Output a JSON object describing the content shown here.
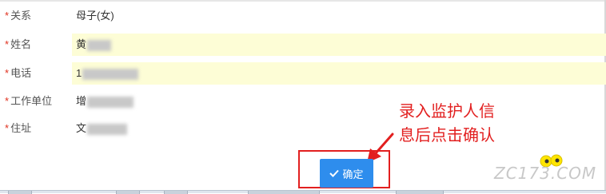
{
  "form": {
    "fields": [
      {
        "label": "关系",
        "value": "母子(女)",
        "required": true
      },
      {
        "label": "姓名",
        "value": "黄",
        "required": true
      },
      {
        "label": "电话",
        "value": "1",
        "required": true
      },
      {
        "label": "工作单位",
        "value": "增",
        "required": true
      },
      {
        "label": "住址",
        "value": "文",
        "required": true
      }
    ],
    "required_mark": "*"
  },
  "annotation": {
    "line1": "录入监护人信",
    "line2": "息后点击确认"
  },
  "confirm_button": {
    "label": "确定",
    "icon": "check-icon"
  },
  "watermark": {
    "text": "ZC173.COM"
  },
  "colors": {
    "accent_blue": "#2e8ded",
    "annotation_red": "#e21f1f",
    "required_red": "#e0301e",
    "highlight_yellow": "#fdfdd6"
  }
}
